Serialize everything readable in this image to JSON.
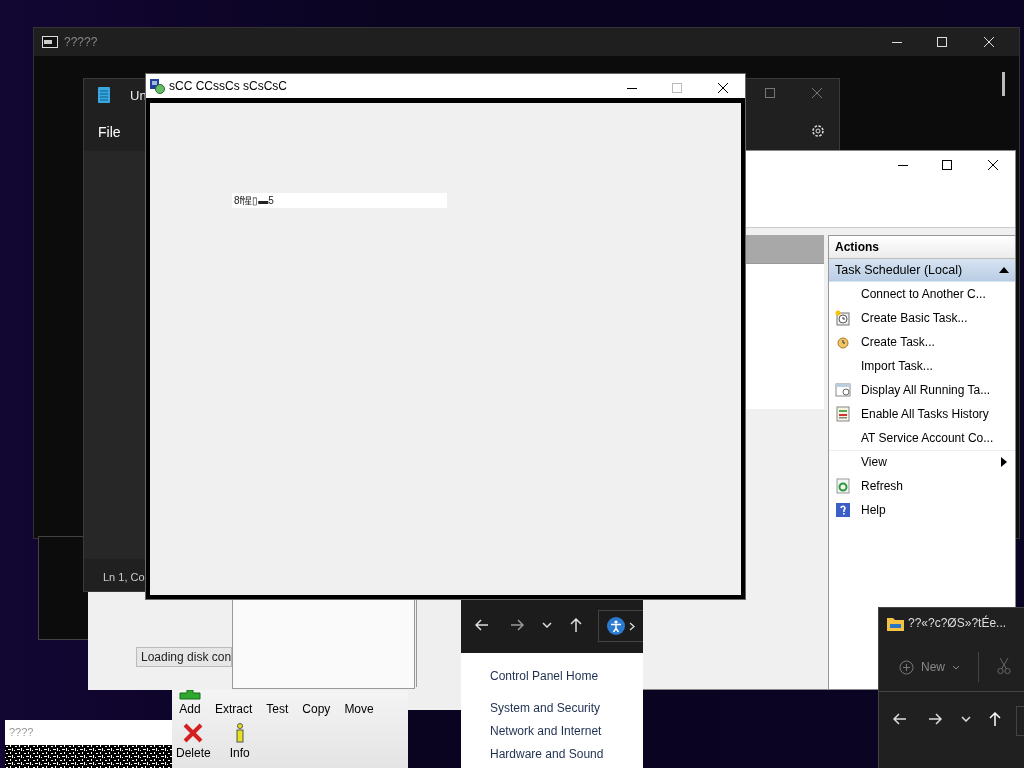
{
  "console_window": {
    "title": "?????"
  },
  "notepad_window": {
    "title": "Un",
    "menu": [
      "File"
    ],
    "status": "Ln 1, Co"
  },
  "dialog": {
    "title": "sCC CCssCs  sCsCsC",
    "field_value": "8f惺▯▬5"
  },
  "task_scheduler": {
    "actions_header": "Actions",
    "section": {
      "label": "Task Scheduler (Local)",
      "expanded": true
    },
    "actions": [
      {
        "label": "Connect to Another C...",
        "kind": "plain"
      },
      {
        "label": "Create Basic Task...",
        "kind": "basic-task"
      },
      {
        "label": "Create Task...",
        "kind": "task"
      },
      {
        "label": "Import Task...",
        "kind": "plain"
      },
      {
        "label": "Display All Running Ta...",
        "kind": "running"
      },
      {
        "label": "Enable All Tasks History",
        "kind": "history"
      },
      {
        "label": "AT Service Account Co...",
        "kind": "plain"
      },
      {
        "label": "View",
        "kind": "submenu"
      },
      {
        "label": "Refresh",
        "kind": "refresh"
      },
      {
        "label": "Help",
        "kind": "help"
      }
    ]
  },
  "disk_window": {
    "status": "Loading disk con"
  },
  "archiver": {
    "toolbar": [
      {
        "label": "Add",
        "kind": "add"
      },
      {
        "label": "Extract",
        "kind": "plain"
      },
      {
        "label": "Test",
        "kind": "plain"
      },
      {
        "label": "Copy",
        "kind": "plain"
      },
      {
        "label": "Move",
        "kind": "plain"
      },
      {
        "label": "Delete",
        "kind": "delete"
      },
      {
        "label": "Info",
        "kind": "info"
      }
    ]
  },
  "control_panel": {
    "links": [
      "Control Panel Home",
      "System and Security",
      "Network and Internet",
      "Hardware and Sound"
    ]
  },
  "explorer": {
    "title": "??«?c?ØS»?tÉe...",
    "new_button": "New"
  },
  "small_window": {
    "title": "????"
  }
}
